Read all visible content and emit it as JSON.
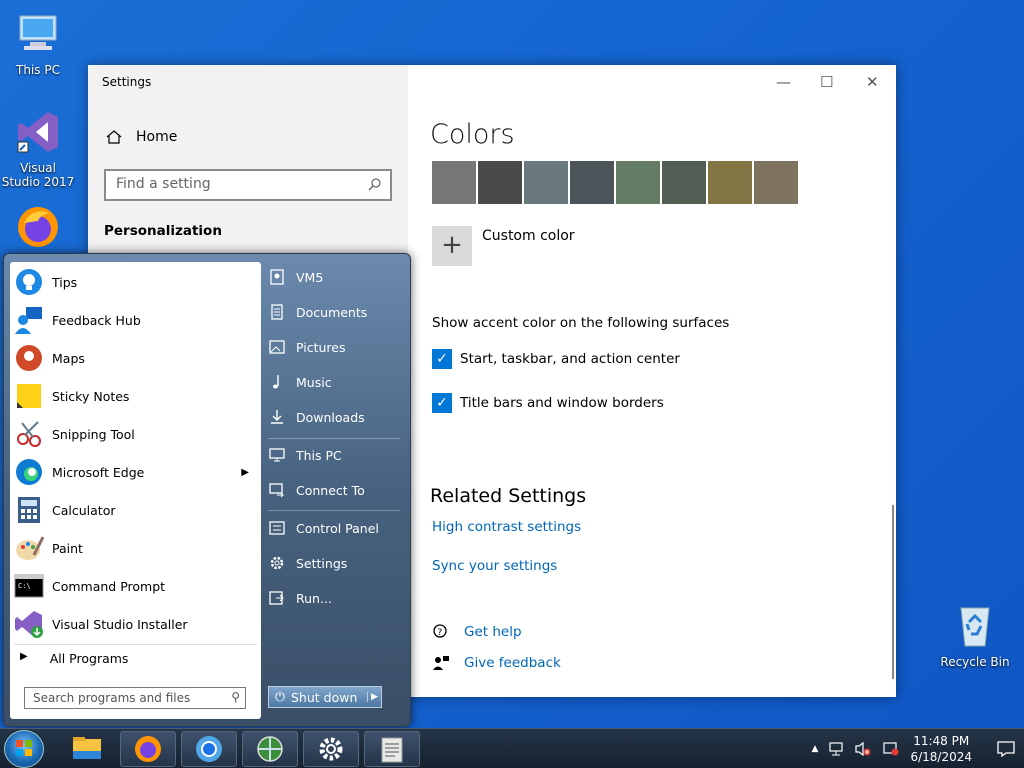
{
  "desktop": {
    "icons": [
      {
        "label": "This PC"
      },
      {
        "label": "Visual Studio 2017"
      },
      {
        "label": "Recycle Bin"
      }
    ]
  },
  "settings": {
    "window_title": "Settings",
    "home": "Home",
    "search_placeholder": "Find a setting",
    "section": "Personalization",
    "page_title": "Colors",
    "swatches": [
      "#767676",
      "#4c4a48",
      "#69797e",
      "#4a5459",
      "#647c64",
      "#525e54",
      "#847545",
      "#7e735f"
    ],
    "custom_color": "Custom color",
    "show_accent": "Show accent color on the following surfaces",
    "checkboxes": [
      {
        "label": "Start, taskbar, and action center",
        "checked": true
      },
      {
        "label": "Title bars and window borders",
        "checked": true
      }
    ],
    "related_title": "Related Settings",
    "links": [
      "High contrast settings",
      "Sync your settings"
    ],
    "help": "Get help",
    "feedback": "Give feedback"
  },
  "start_menu": {
    "programs": [
      {
        "label": "Tips",
        "icon": "tips-icon"
      },
      {
        "label": "Feedback Hub",
        "icon": "feedback-hub-icon"
      },
      {
        "label": "Maps",
        "icon": "maps-icon"
      },
      {
        "label": "Sticky Notes",
        "icon": "sticky-notes-icon"
      },
      {
        "label": "Snipping Tool",
        "icon": "snipping-tool-icon"
      },
      {
        "label": "Microsoft Edge",
        "icon": "edge-icon"
      },
      {
        "label": "Calculator",
        "icon": "calculator-icon"
      },
      {
        "label": "Paint",
        "icon": "paint-icon"
      },
      {
        "label": "Command Prompt",
        "icon": "cmd-icon"
      },
      {
        "label": "Visual Studio Installer",
        "icon": "vs-installer-icon"
      }
    ],
    "all_programs": "All Programs",
    "search_placeholder": "Search programs and files",
    "right_items": [
      "VM5",
      "Documents",
      "Pictures",
      "Music",
      "Downloads",
      "This PC",
      "Connect To",
      "Control Panel",
      "Settings",
      "Run..."
    ],
    "shutdown": "Shut down"
  },
  "taskbar": {
    "time": "11:48 PM",
    "date": "6/18/2024"
  }
}
